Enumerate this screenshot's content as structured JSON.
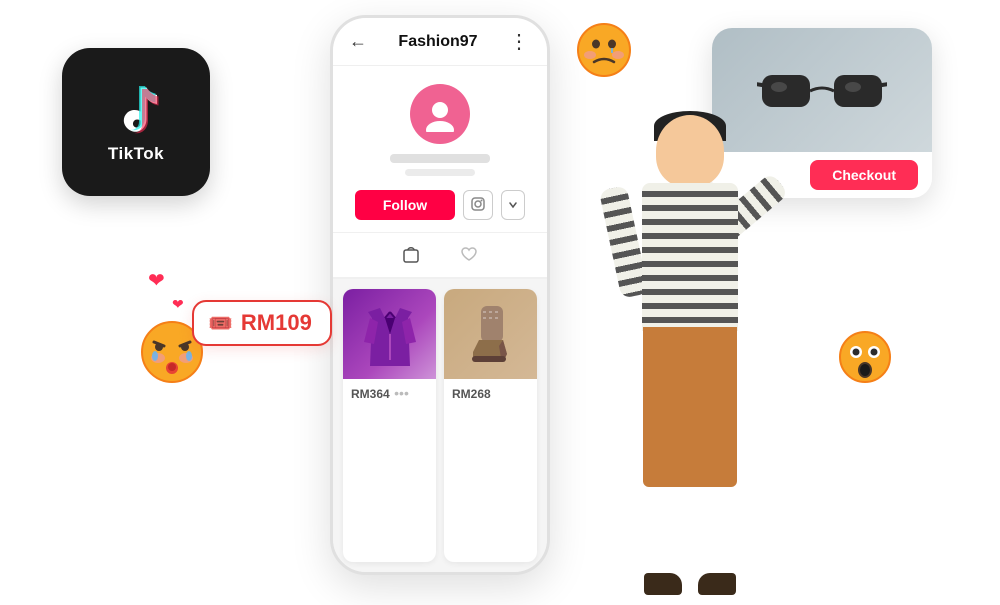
{
  "tiktok": {
    "label": "TikTok"
  },
  "phone": {
    "title": "Fashion97",
    "back_icon": "←",
    "more_icon": "⋮",
    "follow_label": "Follow",
    "product1_price": "RM364",
    "product2_price": "RM268"
  },
  "checkout_card": {
    "checkout_label": "Checkout"
  },
  "price_badge": {
    "price": "RM109"
  },
  "emojis": {
    "cry": "😤",
    "sad": "🥺",
    "shock": "😮"
  },
  "hearts": "❤"
}
